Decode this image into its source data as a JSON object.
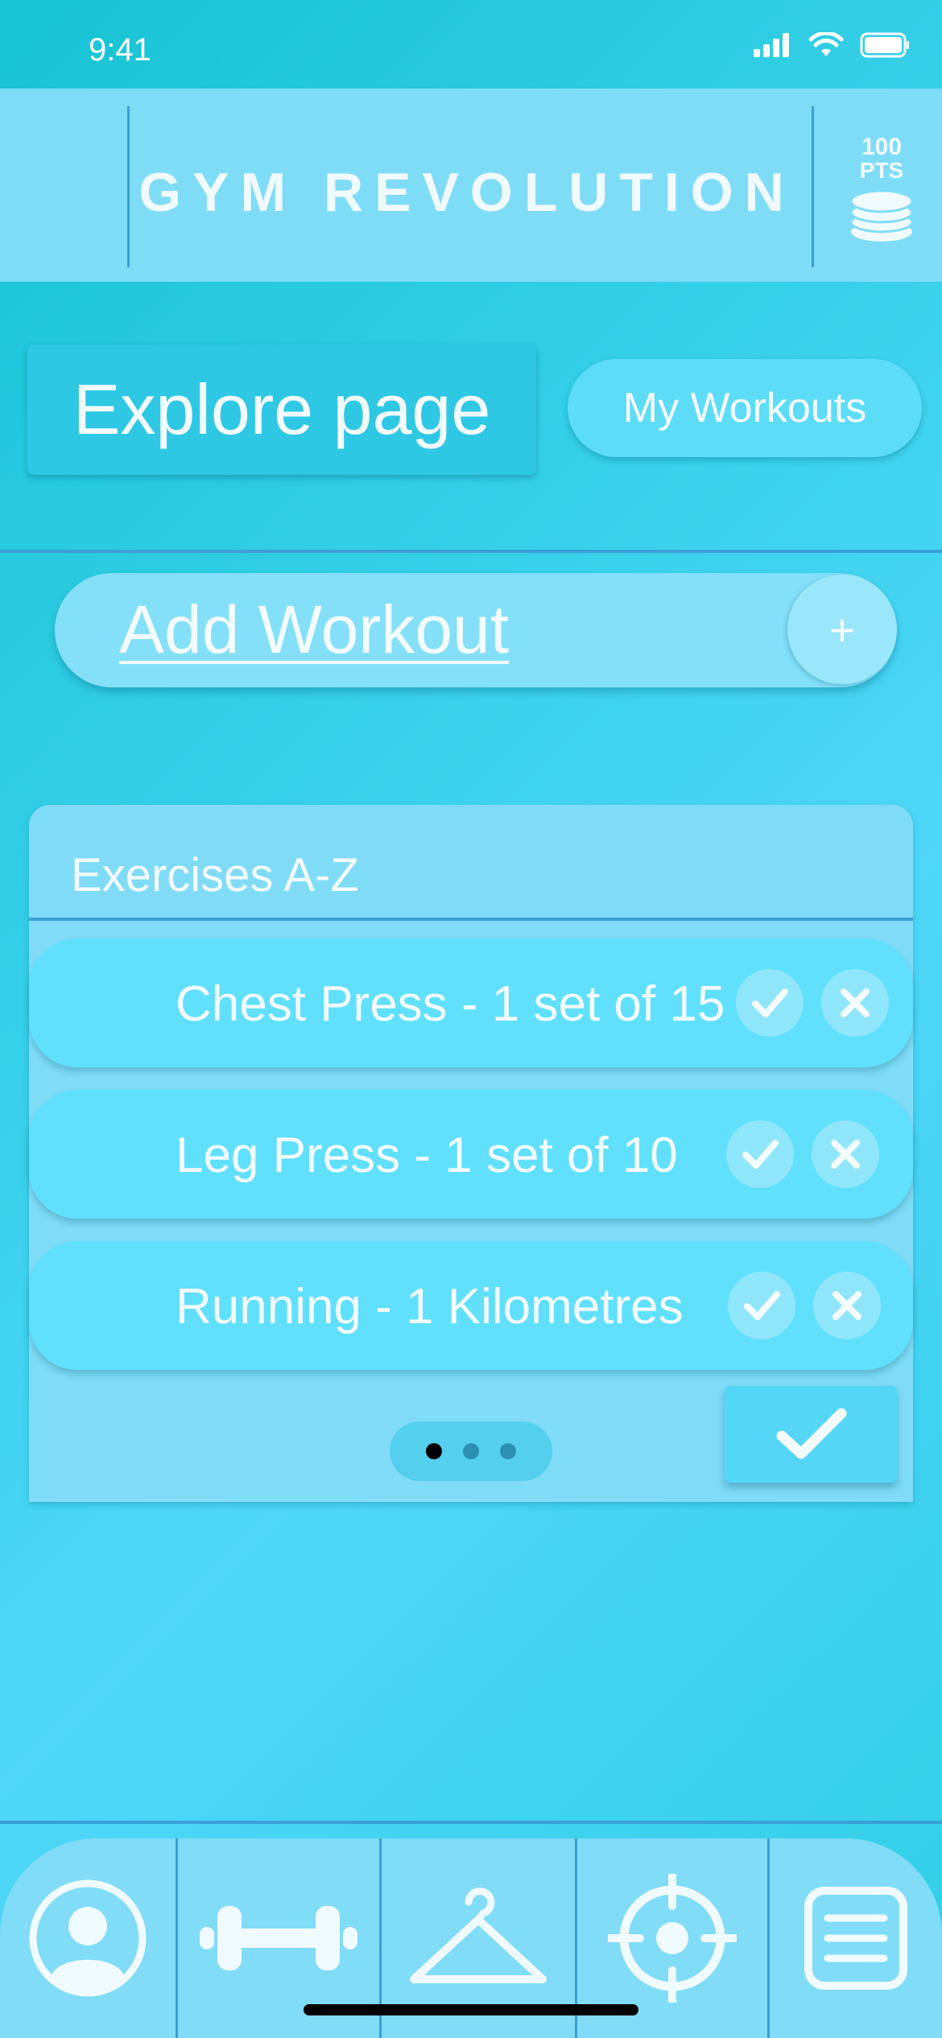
{
  "status_bar": {
    "time": "9:41"
  },
  "header": {
    "brand": "GYM REVOLUTION",
    "points_value": "100",
    "points_unit": "PTS"
  },
  "nav_buttons": {
    "explore": "Explore page",
    "my_workouts": "My Workouts"
  },
  "add_workout": {
    "label": "Add Workout",
    "plus": "+"
  },
  "exercises": {
    "title": "Exercises A-Z",
    "items": [
      {
        "label": "Chest Press - 1 set of 15"
      },
      {
        "label": "Leg Press - 1 set of 10"
      },
      {
        "label": "Running - 1 Kilometres"
      }
    ],
    "pager": {
      "pages": 3,
      "active": 1
    }
  },
  "tab_bar": {
    "items": [
      {
        "icon": "profile-icon"
      },
      {
        "icon": "dumbbell-icon"
      },
      {
        "icon": "hanger-icon"
      },
      {
        "icon": "target-icon"
      },
      {
        "icon": "menu-list-icon"
      }
    ]
  },
  "colors": {
    "background": "#2fcfe6",
    "header": "#7fdcf7",
    "divider": "#3a9fd6",
    "accent_button": "#2ec8e4"
  }
}
